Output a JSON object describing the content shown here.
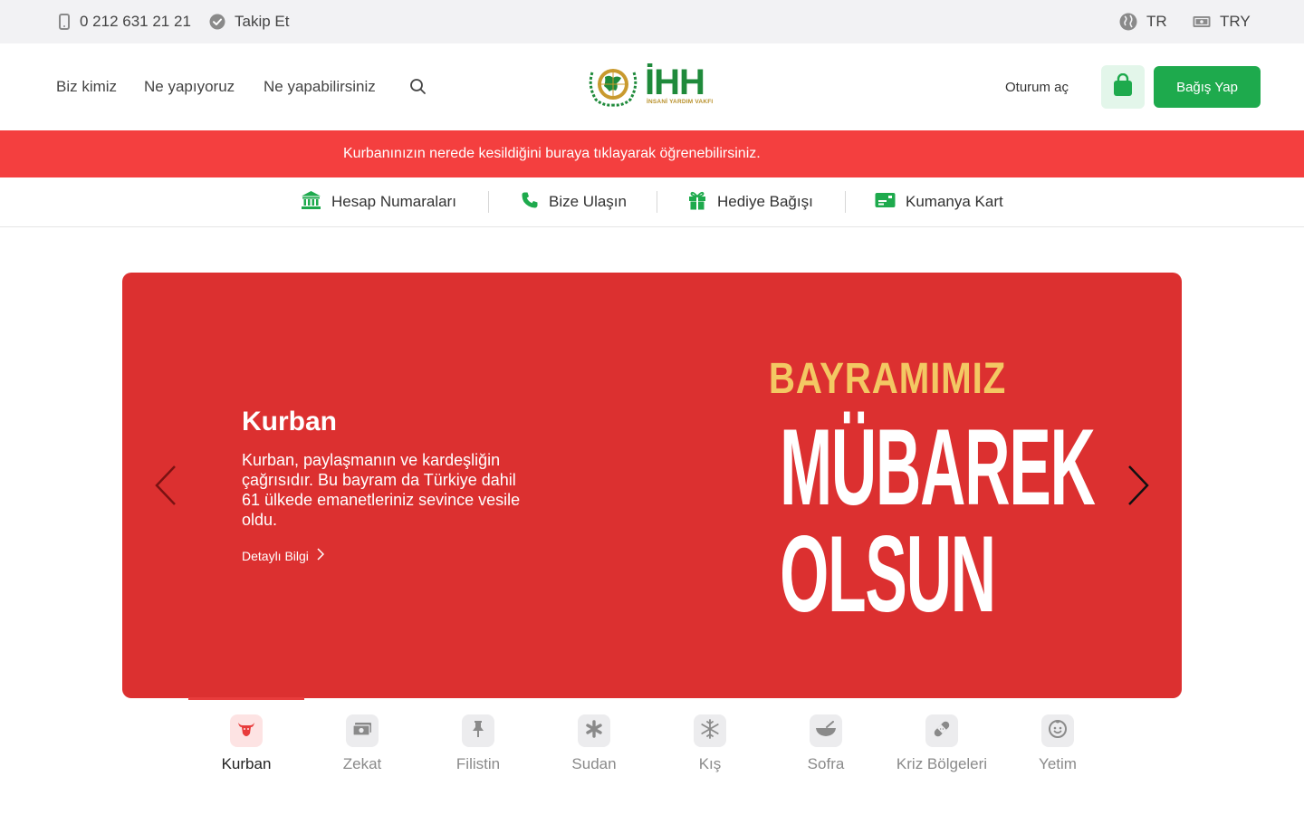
{
  "topbar": {
    "phone": "0 212 631 21 21",
    "follow": "Takip Et",
    "language": "TR",
    "currency": "TRY"
  },
  "header": {
    "nav": [
      "Biz kimiz",
      "Ne yapıyoruz",
      "Ne yapabilirsiniz"
    ],
    "logo_text": "İHH",
    "logo_subtitle": "İNSANİ YARDIM VAKFI",
    "login": "Oturum aç",
    "donate": "Bağış Yap"
  },
  "notice": {
    "text": "Kurbanınızın nerede kesildiğini buraya tıklayarak öğrenebilirsiniz."
  },
  "quick_links": [
    {
      "label": "Hesap Numaraları",
      "icon": "bank-icon"
    },
    {
      "label": "Bize Ulaşın",
      "icon": "phone-icon"
    },
    {
      "label": "Hediye Bağışı",
      "icon": "gift-icon"
    },
    {
      "label": "Kumanya Kart",
      "icon": "card-icon"
    }
  ],
  "hero": {
    "title": "Kurban",
    "description": "Kurban, paylaşmanın ve kardeşliğin çağrısıdır. Bu bayram da Türkiye dahil 61 ülkede emanetleriniz sevince vesile oldu.",
    "link": "Detaylı Bilgi",
    "art_line1": "BAYRAMIMIZ",
    "art_line2": "MÜBAREK",
    "art_line3": "OLSUN"
  },
  "categories": [
    {
      "label": "Kurban",
      "icon": "cow-icon",
      "active": true
    },
    {
      "label": "Zekat",
      "icon": "money-icon"
    },
    {
      "label": "Filistin",
      "icon": "pin-icon"
    },
    {
      "label": "Sudan",
      "icon": "asterisk-icon"
    },
    {
      "label": "Kış",
      "icon": "snowflake-icon"
    },
    {
      "label": "Sofra",
      "icon": "bowl-icon"
    },
    {
      "label": "Kriz Bölgeleri",
      "icon": "bandage-icon"
    },
    {
      "label": "Yetim",
      "icon": "child-face-icon"
    }
  ],
  "colors": {
    "brand_green": "#1eaa4d",
    "notice_red": "#f43f3f",
    "hero_red": "#dc3030",
    "art_gold": "#f3c863"
  }
}
